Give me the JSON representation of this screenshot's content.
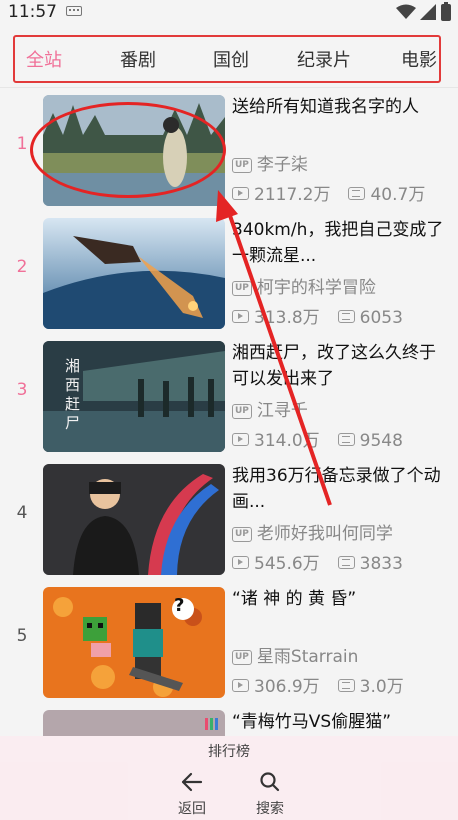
{
  "status_bar": {
    "time": "11:57"
  },
  "tabs": [
    {
      "label": "全站",
      "active": true
    },
    {
      "label": "番剧",
      "active": false
    },
    {
      "label": "国创",
      "active": false
    },
    {
      "label": "纪录片",
      "active": false
    },
    {
      "label": "电影",
      "active": false
    }
  ],
  "videos": [
    {
      "rank": "1",
      "title": "送给所有知道我名字的人",
      "author": "李子柒",
      "views": "2117.2万",
      "danmaku": "40.7万"
    },
    {
      "rank": "2",
      "title": "340km/h，我把自己变成了一颗流星...",
      "author": "柯宇的科学冒险",
      "views": "313.8万",
      "danmaku": "6053"
    },
    {
      "rank": "3",
      "title": "湘西赶尸，改了这么久终于可以发出来了",
      "author": "江寻千",
      "views": "314.0万",
      "danmaku": "9548"
    },
    {
      "rank": "4",
      "title": "我用36万行备忘录做了个动画...",
      "author": "老师好我叫何同学",
      "views": "545.6万",
      "danmaku": "3833"
    },
    {
      "rank": "5",
      "title": "“诸 神 的 黄 昏”",
      "author": "星雨Starrain",
      "views": "306.9万",
      "danmaku": "3.0万"
    },
    {
      "rank": "6",
      "title": "“青梅竹马VS偷腥猫”",
      "author": "",
      "views": "",
      "danmaku": ""
    }
  ],
  "thumbnail_overlay_texts": {
    "video_3": "湘西赶尸"
  },
  "up_badge": "UP",
  "bottom_nav": {
    "title": "排行榜",
    "back_label": "返回",
    "search_label": "搜索"
  },
  "accent_color": "#f07098",
  "annotation_color": "#e42424"
}
